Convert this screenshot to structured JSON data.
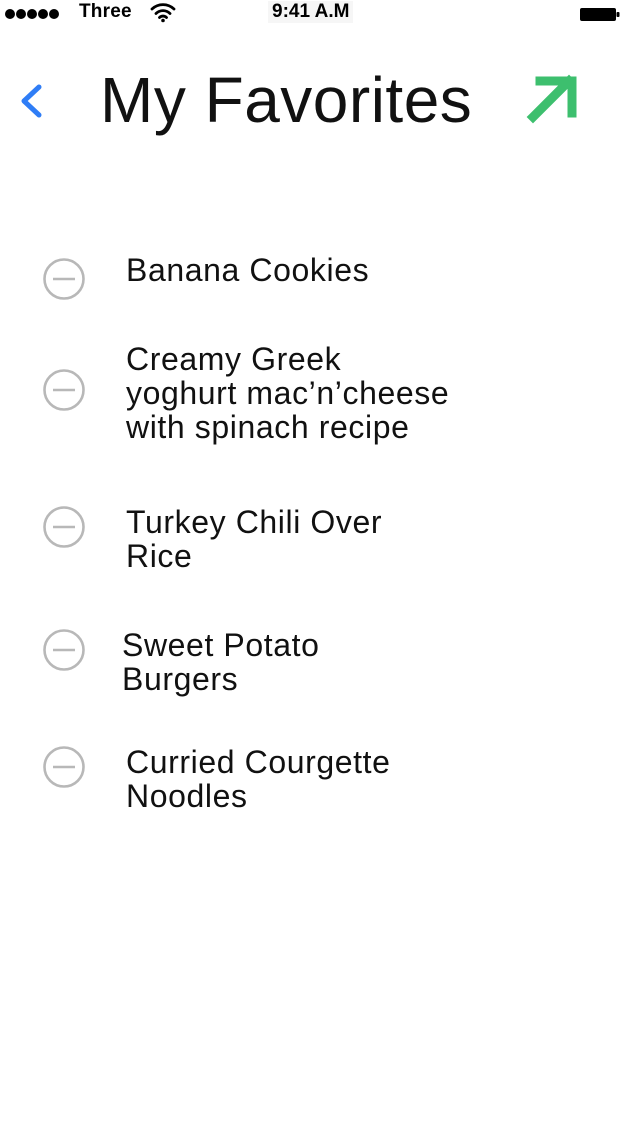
{
  "status_bar": {
    "carrier": "Three",
    "time": "9:41 A.M",
    "signal_icon": "signal-dots-icon",
    "wifi_icon": "wifi-icon",
    "battery_icon": "battery-icon",
    "signal_bars": 5,
    "battery_level": 1.0
  },
  "header": {
    "title": "My Favorites",
    "back_icon": "chevron-left-icon",
    "share_icon": "arrow-up-right-icon"
  },
  "favorites": {
    "remove_icon": "minus-circle-icon",
    "items": [
      {
        "label": "Banana Cookies"
      },
      {
        "label": "Creamy Greek\nyoghurt mac’n’cheese\nwith spinach recipe"
      },
      {
        "label": "Turkey Chili Over\nRice"
      },
      {
        "label": "Sweet Potato\nBurgers"
      },
      {
        "label": "Curried Courgette\nNoodles"
      }
    ]
  },
  "colors": {
    "back_accent": "#2f7df6",
    "share_accent": "#3dbf6e",
    "remove_icon": "#b8b8b8",
    "text": "#111111",
    "background": "#ffffff"
  }
}
